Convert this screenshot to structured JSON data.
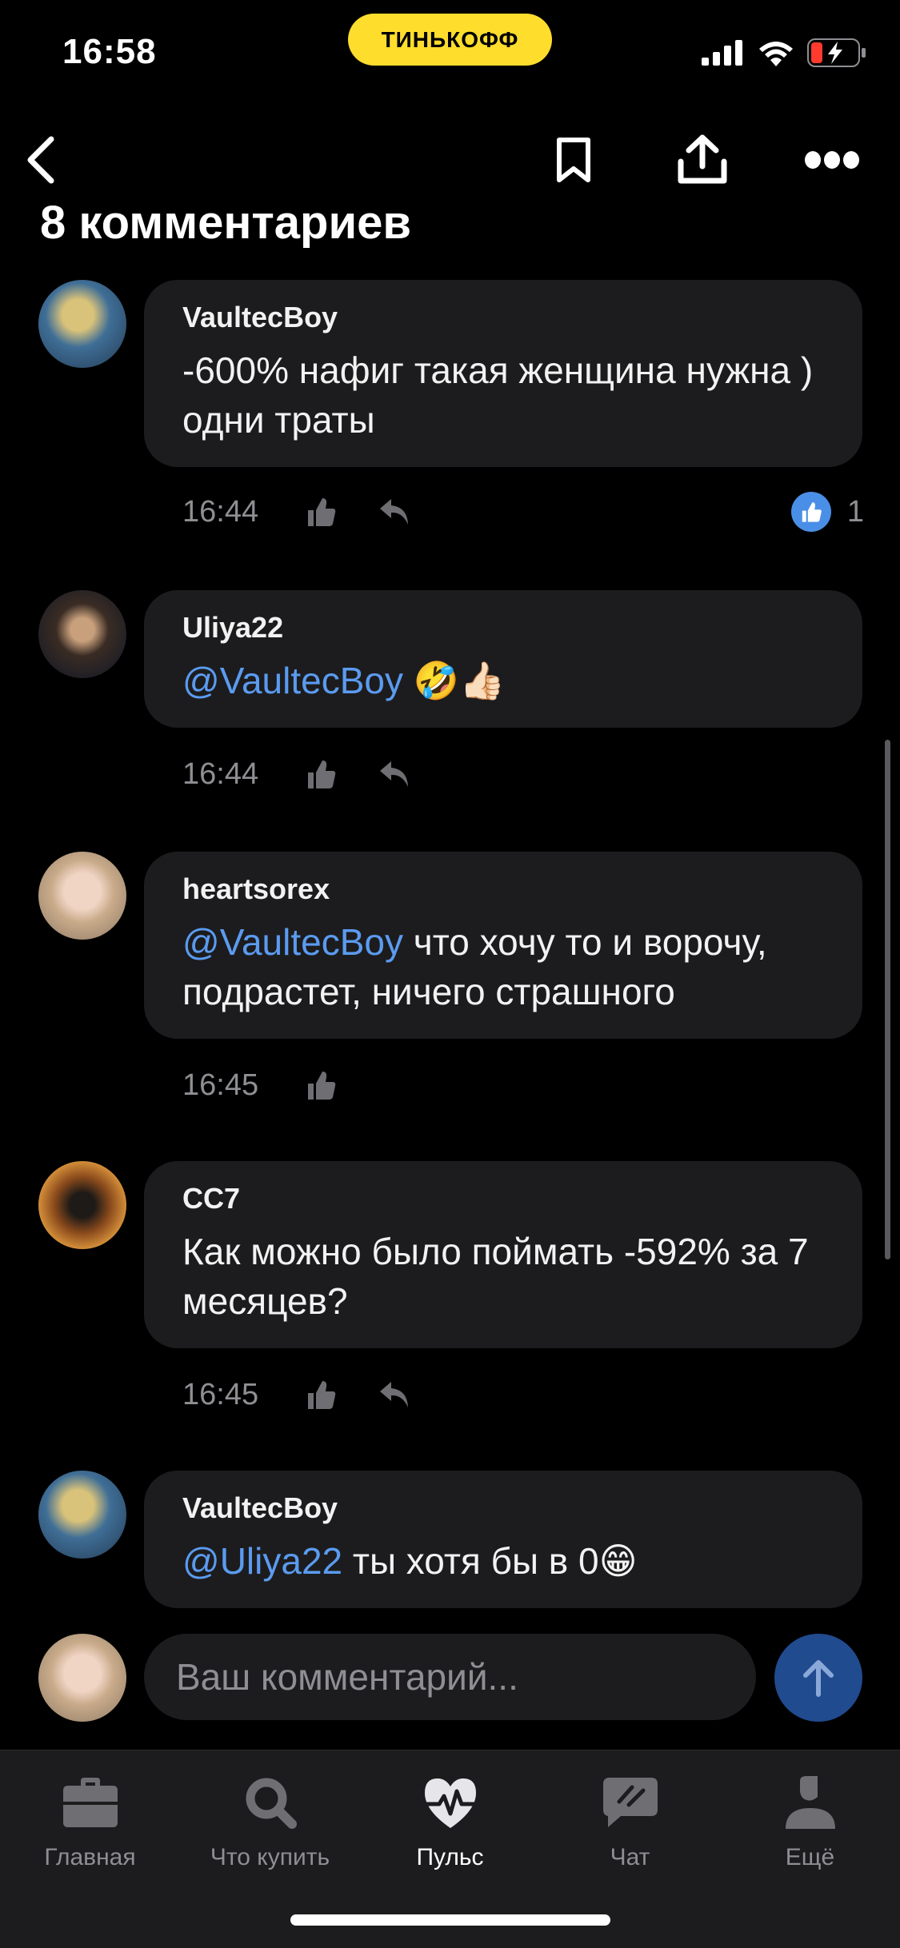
{
  "status_bar": {
    "time": "16:58",
    "brand": "ТИНЬКОФФ"
  },
  "page": {
    "title": "8 комментариев"
  },
  "comments": [
    {
      "author": "VaultecBoy",
      "mention": "",
      "text": "-600% нафиг такая женщина нужна ) одни траты",
      "time": "16:44",
      "likes": "1"
    },
    {
      "author": "Uliya22",
      "mention": "@VaultecBoy",
      "text": " 🤣👍🏻",
      "time": "16:44"
    },
    {
      "author": "heartsorex",
      "mention": "@VaultecBoy",
      "text": " что хочу то и ворочу, подрастет, ничего страшного",
      "time": "16:45"
    },
    {
      "author": "CC7",
      "mention": "",
      "text": "Как можно было поймать -592% за 7 месяцев?",
      "time": "16:45"
    },
    {
      "author": "VaultecBoy",
      "mention": "@Uliya22",
      "text": " ты хотя бы в 0😁"
    }
  ],
  "compose": {
    "placeholder": "Ваш комментарий..."
  },
  "tabs": [
    {
      "label": "Главная",
      "icon": "briefcase-icon"
    },
    {
      "label": "Что купить",
      "icon": "search-icon"
    },
    {
      "label": "Пульс",
      "icon": "pulse-icon",
      "active": true
    },
    {
      "label": "Чат",
      "icon": "chat-icon"
    },
    {
      "label": "Ещё",
      "icon": "profile-icon"
    }
  ],
  "colors": {
    "accent": "#ffdd2d",
    "mention": "#5b9bf0",
    "bubble": "#1c1c1e",
    "like": "#4a8fe7"
  }
}
